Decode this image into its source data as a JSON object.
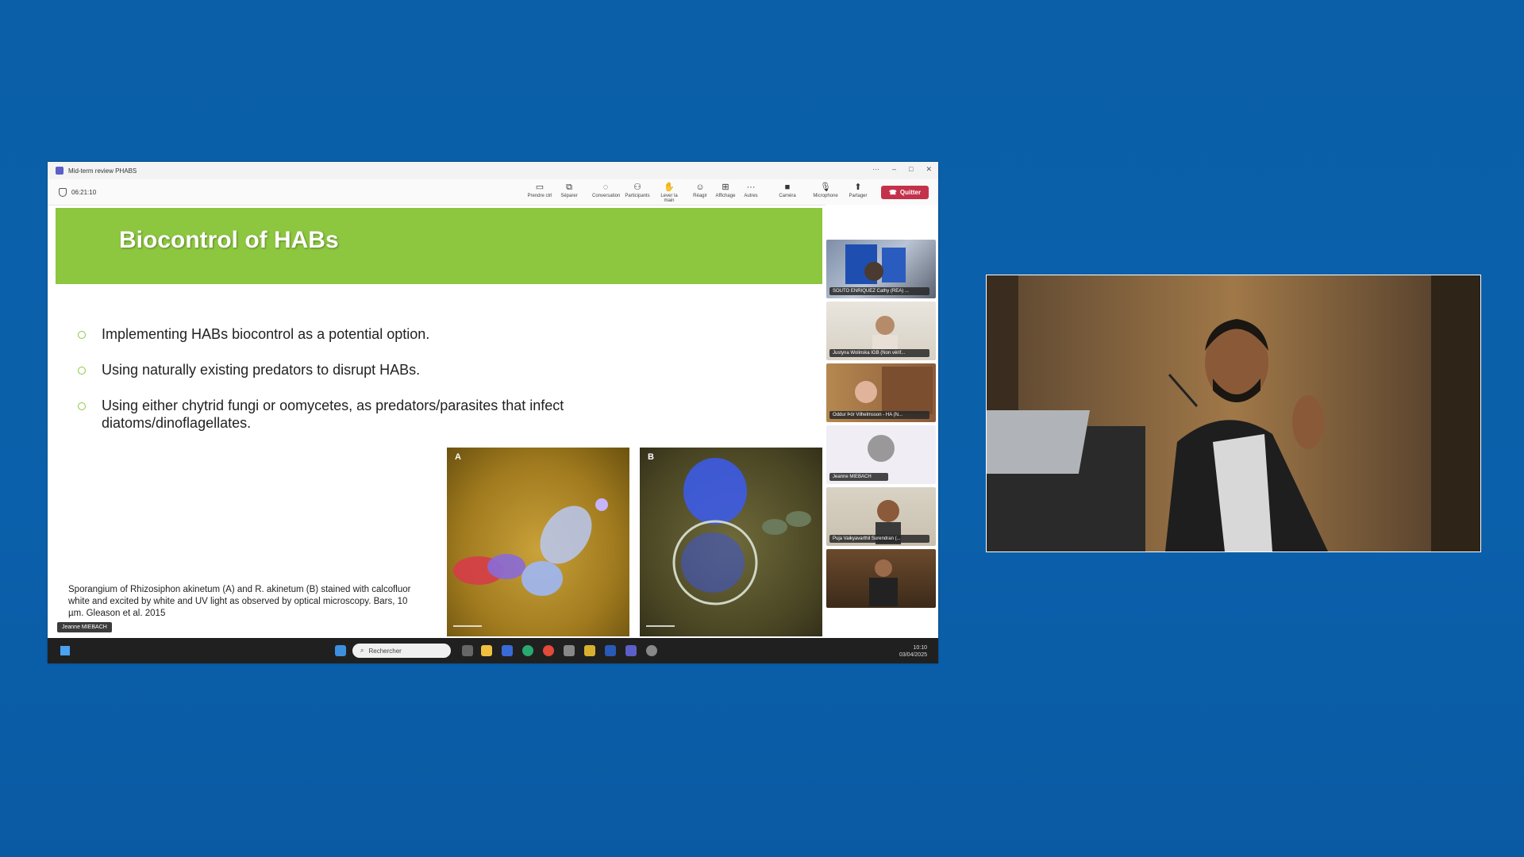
{
  "window": {
    "title": "Mid-term review PHABS",
    "timer": "06:21:10",
    "controls": [
      "···",
      "–",
      "□",
      "✕"
    ]
  },
  "toolbar": {
    "buttons": [
      {
        "label": "Prendre ctrl",
        "icon": "screen-control-icon"
      },
      {
        "label": "Séparer",
        "icon": "pop-out-icon"
      },
      {
        "label": "Conversation",
        "icon": "chat-icon"
      },
      {
        "label": "Participants",
        "icon": "people-icon"
      },
      {
        "label": "Lever la main",
        "icon": "raise-hand-icon"
      },
      {
        "label": "Réagir",
        "icon": "react-icon"
      },
      {
        "label": "Affichage",
        "icon": "view-icon"
      },
      {
        "label": "Autres",
        "icon": "more-icon"
      },
      {
        "label": "Caméra",
        "icon": "camera-icon"
      },
      {
        "label": "Microphone",
        "icon": "microphone-icon"
      },
      {
        "label": "Partager",
        "icon": "share-icon"
      }
    ],
    "quit_label": "Quitter"
  },
  "slide": {
    "title": "Biocontrol of HABs",
    "bullets": [
      "Implementing HABs biocontrol as a potential option.",
      "Using naturally existing predators to disrupt HABs.",
      "Using either chytrid fungi or oomycetes, as predators/parasites that infect diatoms/dinoflagellates."
    ],
    "photo_labels": [
      "A",
      "B"
    ],
    "caption": "Sporangium of Rhizosiphon akinetum (A) and R. akinetum (B) stained with calcofluor white and excited by white and UV light as observed by optical microscopy. Bars, 10 µm. Gleason et al. 2015"
  },
  "presenter_tag": "Jeanne MIEBACH",
  "participants": [
    {
      "name": "SOUTO ENRIQUEZ Cathy (REA) ..."
    },
    {
      "name": "Justyna Wolinska IGB (Non vérif..."
    },
    {
      "name": "Oddur Þór Vilhelmsson - HA (N..."
    },
    {
      "name": "Jeanne MIEBACH"
    },
    {
      "name": "Puja Vaikyavarthil Surendran (..."
    },
    {
      "name": ""
    }
  ],
  "taskbar": {
    "search_placeholder": "Rechercher",
    "time": "10:10",
    "date": "03/04/2025"
  },
  "colors": {
    "desktop_bg": "#0a5fa8",
    "slide_header": "#8dc63f",
    "quit_button": "#c4314b"
  }
}
